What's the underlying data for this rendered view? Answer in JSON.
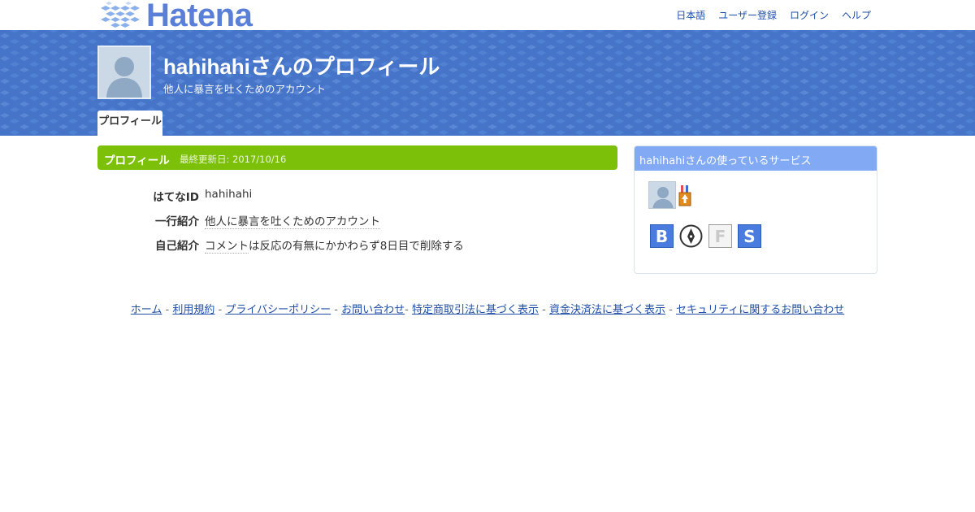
{
  "brand": {
    "logo_text": "Hatena"
  },
  "topnav": [
    {
      "label": "日本語"
    },
    {
      "label": "ユーザー登録"
    },
    {
      "label": "ログイン"
    },
    {
      "label": "ヘルプ"
    }
  ],
  "header": {
    "title": "hahihahiさんのプロフィール",
    "subtitle": "他人に暴言を吐くためのアカウント",
    "tab_label": "プロフィール"
  },
  "profile": {
    "heading": "プロフィール",
    "updated": "最終更新日: 2017/10/16",
    "rows": [
      {
        "label": "はてなID",
        "value": "hahihahi"
      },
      {
        "label": "一行紹介",
        "value": "他人に暴言を吐くためのアカウント"
      },
      {
        "label": "自己紹介",
        "value_link": "コメント",
        "value_rest": "は反応の有無にかかわらず8日目で削除する"
      }
    ]
  },
  "services": {
    "heading": "hahihahiさんの使っているサービス",
    "icons": [
      "bookmark-icon",
      "blog-pen-icon",
      "fotolife-icon",
      "star-icon"
    ],
    "icon_letters": {
      "bookmark": "B",
      "fotolife": "F",
      "star": "S"
    },
    "colors": {
      "blue": "#4a7ce0",
      "gray": "#9a9a9a"
    }
  },
  "footer": {
    "links": [
      "ホーム",
      "利用規約",
      "プライバシーポリシー",
      "お問い合わせ",
      "特定商取引法に基づく表示",
      "資金決済法に基づく表示",
      "セキュリティに関するお問い合わせ"
    ],
    "separator": "-"
  },
  "colors": {
    "header_bg": "#4574c9",
    "profile_head": "#7dc009",
    "services_head": "#82a9f4",
    "link": "#1f4fa8"
  }
}
